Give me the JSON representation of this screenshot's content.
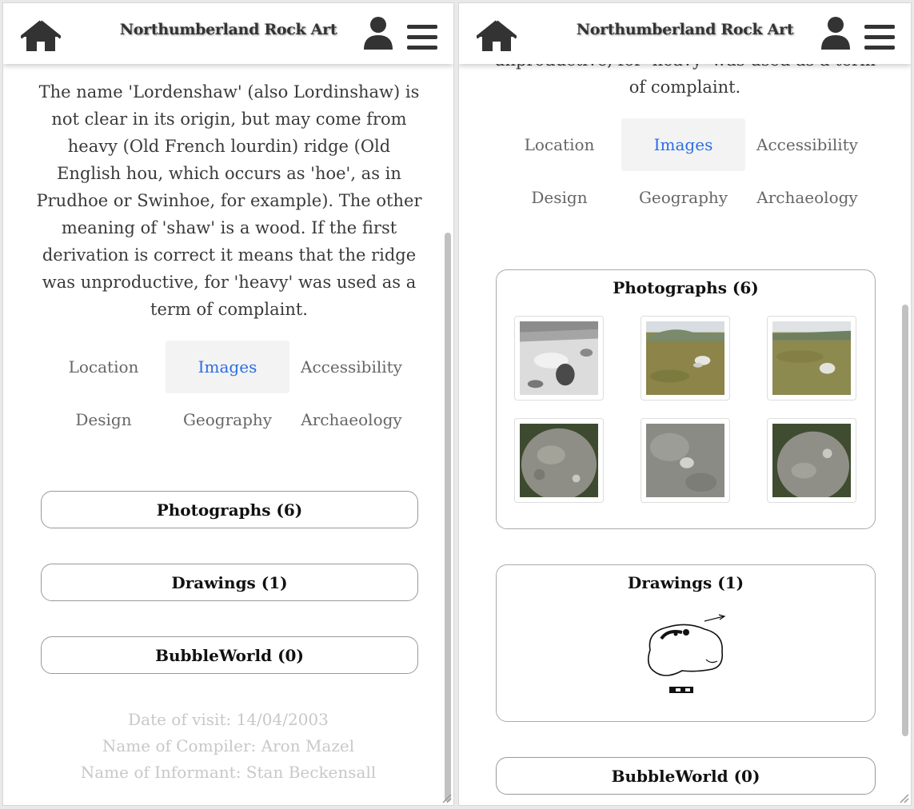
{
  "header": {
    "title": "Northumberland Rock Art",
    "home_icon": "home-icon",
    "user_icon": "user-icon",
    "menu_icon": "hamburger-menu-icon"
  },
  "left": {
    "intro_paragraph": "The name 'Lordenshaw' (also Lordinshaw) is not clear in its origin, but may come from heavy (Old French lourdin) ridge (Old English hou, which occurs as 'hoe', as in Prudhoe or Swinhoe, for example). The other meaning of 'shaw' is a wood. If the first derivation is correct it means that the ridge was unproductive, for 'heavy' was used as a term of complaint.",
    "tabs": [
      {
        "label": "Location",
        "active": false
      },
      {
        "label": "Images",
        "active": true
      },
      {
        "label": "Accessibility",
        "active": false
      },
      {
        "label": "Design",
        "active": false
      },
      {
        "label": "Geography",
        "active": false
      },
      {
        "label": "Archaeology",
        "active": false
      }
    ],
    "buttons": [
      "Photographs (6)",
      "Drawings (1)",
      "BubbleWorld (0)"
    ],
    "footer": {
      "date_of_visit": "Date of visit: 14/04/2003",
      "compiler": "Name of Compiler: Aron Mazel",
      "informant": "Name of Informant: Stan Beckensall"
    }
  },
  "right": {
    "intro_tail": "unproductive, for 'heavy' was used as a term of complaint.",
    "tabs": [
      {
        "label": "Location",
        "active": false
      },
      {
        "label": "Images",
        "active": true
      },
      {
        "label": "Accessibility",
        "active": false
      },
      {
        "label": "Design",
        "active": false
      },
      {
        "label": "Geography",
        "active": false
      },
      {
        "label": "Archaeology",
        "active": false
      }
    ],
    "photographs_title": "Photographs (6)",
    "drawings_title": "Drawings (1)",
    "bubbleworld_label": "BubbleWorld (0)"
  },
  "colors": {
    "active_tab_text": "#2a6de6",
    "active_tab_bg": "#f3f3f3",
    "body_text": "#3a3a3a",
    "muted_text": "#c8c8c8"
  }
}
